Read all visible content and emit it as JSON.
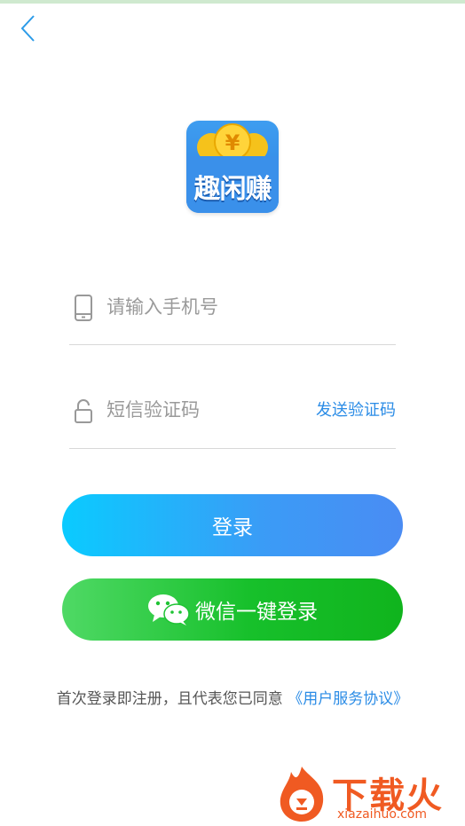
{
  "header": {
    "back_icon": "chevron-left-icon"
  },
  "app": {
    "logo_text": "趣闲赚",
    "logo_coin_symbol": "¥"
  },
  "form": {
    "phone": {
      "placeholder": "请输入手机号",
      "value": "",
      "icon": "phone-icon"
    },
    "code": {
      "placeholder": "短信验证码",
      "value": "",
      "icon": "lock-icon",
      "send_label": "发送验证码"
    }
  },
  "buttons": {
    "login_label": "登录",
    "wechat_label": "微信一键登录",
    "wechat_icon": "wechat-icon"
  },
  "agreement": {
    "text": "首次登录即注册，且代表您已同意",
    "link": "《用户服务协议》"
  },
  "watermark": {
    "title": "下载火",
    "subtitle": "xiazaihuo.com"
  },
  "colors": {
    "accent_blue": "#2b8ce6",
    "login_gradient": [
      "#0acbff",
      "#4a8cf3"
    ],
    "wechat_gradient": [
      "#4fd965",
      "#10b41d"
    ],
    "watermark": "#f05a22"
  }
}
